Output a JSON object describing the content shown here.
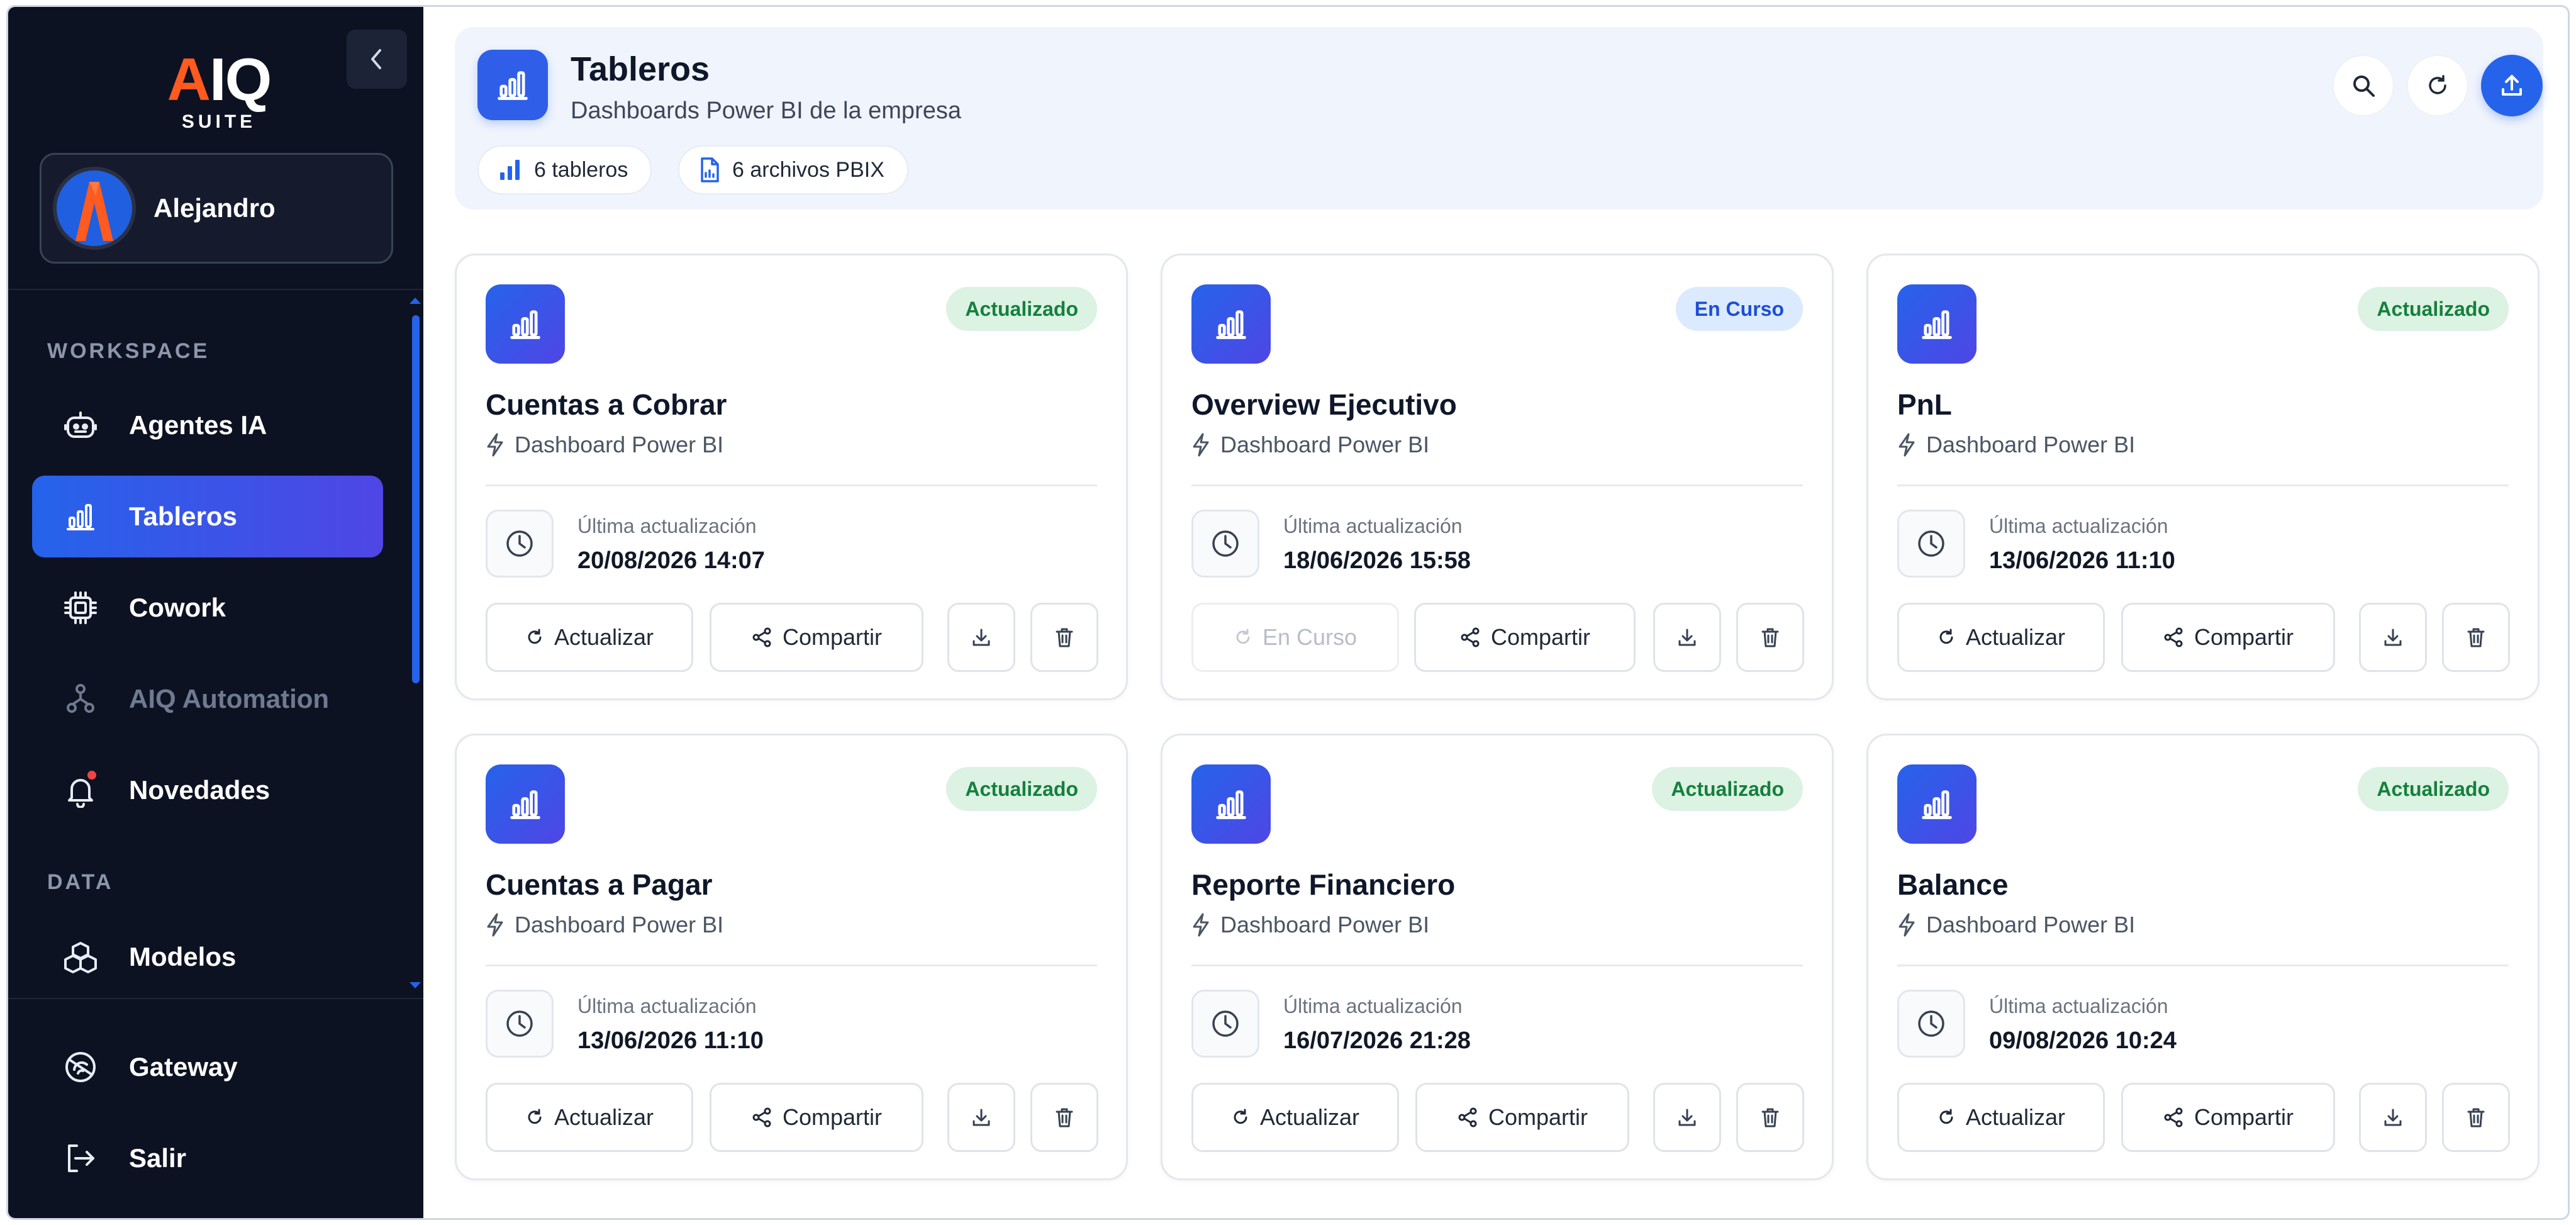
{
  "brand": {
    "logo_main": "AIQ",
    "logo_sub": "SUITE"
  },
  "user": {
    "name": "Alejandro"
  },
  "sidebar": {
    "sections": [
      {
        "label": "WORKSPACE"
      },
      {
        "label": "DATA"
      }
    ],
    "items": [
      {
        "label": "Agentes IA",
        "icon": "robot-icon",
        "active": false
      },
      {
        "label": "Tableros",
        "icon": "bar-chart-icon",
        "active": true
      },
      {
        "label": "Cowork",
        "icon": "chip-icon",
        "active": false
      },
      {
        "label": "AIQ Automation",
        "icon": "network-icon",
        "active": false,
        "disabled": true
      },
      {
        "label": "Novedades",
        "icon": "bell-icon",
        "active": false,
        "notification": true
      },
      {
        "label": "Modelos",
        "icon": "cubes-icon",
        "active": false
      }
    ],
    "bottom": [
      {
        "label": "Gateway",
        "icon": "gateway-icon"
      },
      {
        "label": "Salir",
        "icon": "logout-icon"
      }
    ]
  },
  "header": {
    "title": "Tableros",
    "subtitle": "Dashboards Power BI de la empresa",
    "chips": [
      {
        "label": "6 tableros",
        "icon": "bar-chart-icon"
      },
      {
        "label": "6 archivos PBIX",
        "icon": "file-icon"
      }
    ],
    "actions": [
      "search-icon",
      "refresh-icon",
      "upload-icon"
    ]
  },
  "card_common": {
    "subtitle": "Dashboard Power BI",
    "update_label": "Última actualización",
    "refresh_label": "Actualizar",
    "share_label": "Compartir",
    "running_label": "En Curso"
  },
  "colors": {
    "accent": "#2563eb",
    "accent2": "#4f46e5",
    "ok_bg": "#dcf2e3",
    "ok_text": "#15803d",
    "run_bg": "#dbeafe",
    "run_text": "#1d4ed8",
    "sidebar_bg": "#0d1222"
  },
  "cards": [
    {
      "title": "Cuentas a Cobrar",
      "status": "Actualizado",
      "status_type": "ok",
      "updated": "20/08/2026 14:07",
      "refreshing": false
    },
    {
      "title": "Overview Ejecutivo",
      "status": "En Curso",
      "status_type": "run",
      "updated": "18/06/2026 15:58",
      "refreshing": true
    },
    {
      "title": "PnL",
      "status": "Actualizado",
      "status_type": "ok",
      "updated": "13/06/2026 11:10",
      "refreshing": false
    },
    {
      "title": "Cuentas a Pagar",
      "status": "Actualizado",
      "status_type": "ok",
      "updated": "13/06/2026 11:10",
      "refreshing": false
    },
    {
      "title": "Reporte Financiero",
      "status": "Actualizado",
      "status_type": "ok",
      "updated": "16/07/2026 21:28",
      "refreshing": false
    },
    {
      "title": "Balance",
      "status": "Actualizado",
      "status_type": "ok",
      "updated": "09/08/2026 10:24",
      "refreshing": false
    }
  ]
}
